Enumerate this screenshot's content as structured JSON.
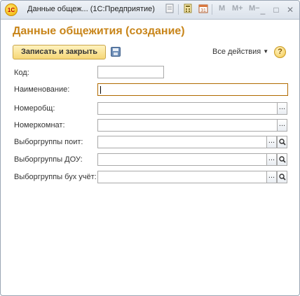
{
  "window": {
    "title": "Данные общеж...   (1С:Предприятие)",
    "logo_text": "1С",
    "toolbar": {
      "icons": [
        "page-icon",
        "calculator-icon",
        "calendar-icon"
      ],
      "calendar_day": "31",
      "memory_buttons": [
        "M",
        "M+",
        "M−"
      ]
    },
    "controls": {
      "minimize": "_",
      "maximize": "□",
      "close": "✕"
    }
  },
  "form": {
    "title": "Данные общежития (создание)",
    "save_close_label": "Записать и закрыть",
    "all_actions_label": "Все действия",
    "help_label": "?",
    "fields": [
      {
        "label": "Код:",
        "value": ""
      },
      {
        "label": "Наименование:",
        "value": ""
      },
      {
        "label": "Номеробщ:",
        "value": "",
        "button": "..."
      },
      {
        "label": "Номеркомнат:",
        "value": "",
        "button": "..."
      },
      {
        "label": "Выборгруппы поит:",
        "value": "",
        "button": "..."
      },
      {
        "label": "Выборгруппы ДОУ:",
        "value": "",
        "button": "..."
      },
      {
        "label": "Выборгруппы бух учёт:",
        "value": "",
        "button": "..."
      }
    ]
  },
  "colors": {
    "title_accent": "#c8851a",
    "primary_button": "#f6d776",
    "focused_border": "#b06a00"
  }
}
